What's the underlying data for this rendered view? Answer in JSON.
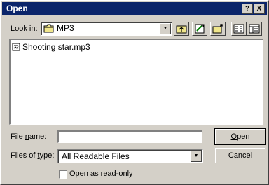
{
  "window": {
    "title": "Open"
  },
  "titlebar_buttons": [
    "?",
    "X"
  ],
  "look_in": {
    "label": "Look in:",
    "label_accesskey_prefix": "Look ",
    "label_accesskey": "i",
    "label_suffix": "n:",
    "value": "MP3"
  },
  "toolbar": {
    "icons": [
      "up-folder-icon",
      "desktop-icon",
      "new-folder-icon",
      "list-view-icon",
      "details-view-icon"
    ]
  },
  "files": [
    {
      "name": "Shooting star.mp3",
      "icon": "music-file-icon"
    }
  ],
  "file_name": {
    "label_prefix": "File ",
    "label_accesskey": "n",
    "label_suffix": "ame:",
    "value": ""
  },
  "files_of_type": {
    "label_prefix": "Files of ",
    "label_accesskey": "t",
    "label_suffix": "ype:",
    "value": "All Readable Files"
  },
  "buttons": {
    "open": {
      "accesskey": "O",
      "rest": "pen"
    },
    "cancel": "Cancel"
  },
  "read_only": {
    "prefix": "Open as ",
    "accesskey": "r",
    "suffix": "ead-only",
    "checked": false
  }
}
